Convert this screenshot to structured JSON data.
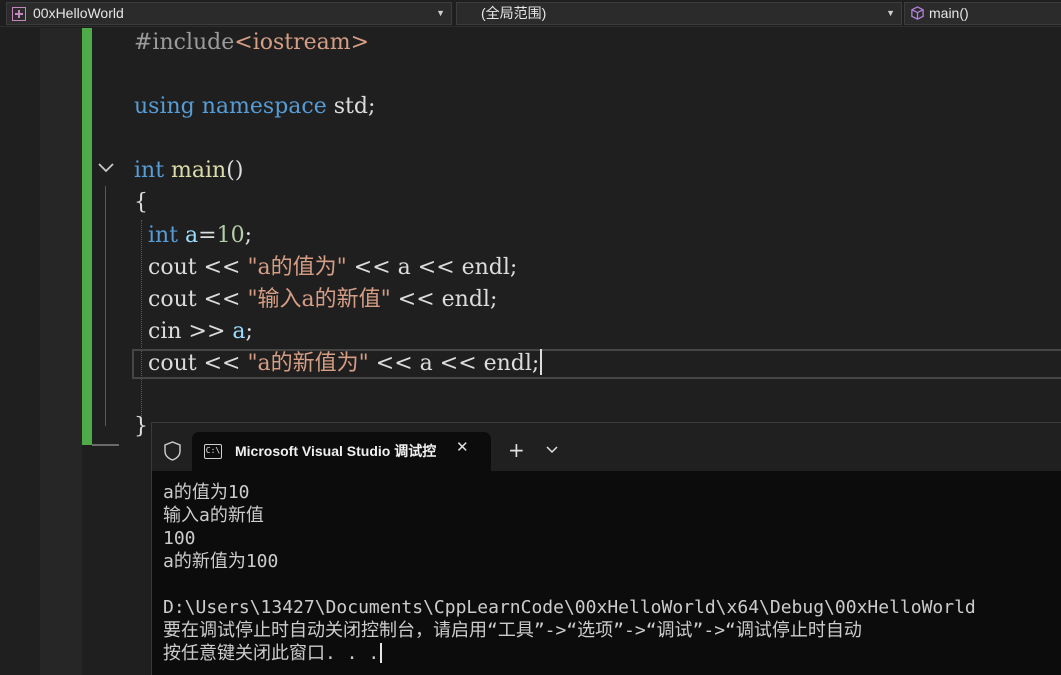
{
  "navbar": {
    "project": "00xHelloWorld",
    "scope": "(全局范围)",
    "function": "main()"
  },
  "editor": {
    "lines": {
      "include_directive": "#include",
      "include_header": "<iostream>",
      "using_kw": "using",
      "namespace_kw": "namespace",
      "using_rest": " std;",
      "main_type": "int",
      "main_name": "main",
      "main_parens": "()",
      "open_brace": "{",
      "l1_type": "int",
      "l1_var": "a",
      "l1_op": "=",
      "l1_num": "10",
      "l1_end": ";",
      "l2_pre": "cout << ",
      "l2_str": "\"a的值为\"",
      "l2_post": " << a << endl;",
      "l3_pre": "cout << ",
      "l3_str": "\"输入a的新值\"",
      "l3_post": " << endl;",
      "l4_pre": "cin >> ",
      "l4_var": "a",
      "l4_post": ";",
      "l5_pre": "cout << ",
      "l5_str": "\"a的新值为\"",
      "l5_post": " << a << endl;",
      "close_brace": "}"
    }
  },
  "terminal": {
    "tab_title": "Microsoft Visual Studio 调试控",
    "output": [
      "a的值为10",
      "输入a的新值",
      "100",
      "a的新值为100",
      "",
      "D:\\Users\\13427\\Documents\\CppLearnCode\\00xHelloWorld\\x64\\Debug\\00xHelloWorld",
      "要在调试停止时自动关闭控制台，请启用“工具”->“选项”->“调试”->“调试停止时自动",
      "按任意键关闭此窗口. . ."
    ]
  },
  "colors": {
    "editor_bg": "#1f1f1f",
    "change_bar": "#4faa4a",
    "keyword": "#569cd6",
    "string": "#d69d85",
    "function": "#dcdcaa",
    "variable": "#9cdcfe",
    "number": "#b5cea8",
    "terminal_bg": "#0c0c0c"
  }
}
